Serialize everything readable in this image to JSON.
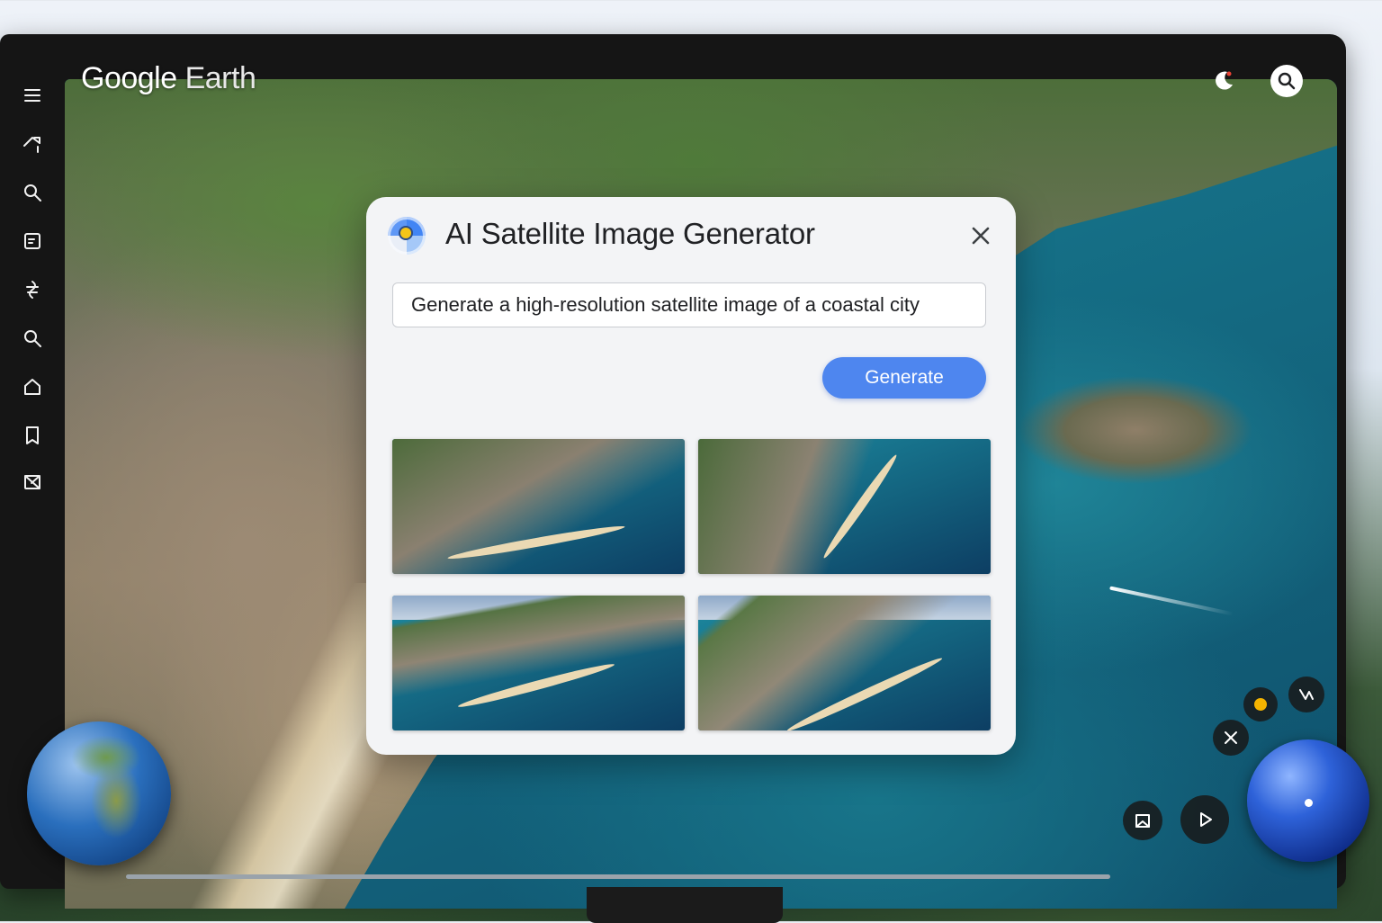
{
  "app": {
    "brand_google": "Google",
    "brand_earth": "Earth"
  },
  "sidebar": {
    "items": [
      {
        "icon": "menu-icon"
      },
      {
        "icon": "voyager-icon"
      },
      {
        "icon": "search-icon"
      },
      {
        "icon": "projects-icon"
      },
      {
        "icon": "feeling-lucky-icon"
      },
      {
        "icon": "search-places-icon"
      },
      {
        "icon": "home-icon"
      },
      {
        "icon": "bookmark-icon"
      },
      {
        "icon": "map-style-icon"
      }
    ]
  },
  "dialog": {
    "title": "AI Satellite Image Generator",
    "prompt_value": "Generate a high-resolution satellite image of a coastal city",
    "generate_label": "Generate",
    "thumbnails": [
      {
        "alt": "coastal-city-1"
      },
      {
        "alt": "coastal-city-2"
      },
      {
        "alt": "coastal-city-3"
      },
      {
        "alt": "coastal-city-4"
      }
    ]
  },
  "colors": {
    "accent": "#4e86ef",
    "dialog_bg": "#f3f4f6",
    "title_text": "#202124"
  }
}
